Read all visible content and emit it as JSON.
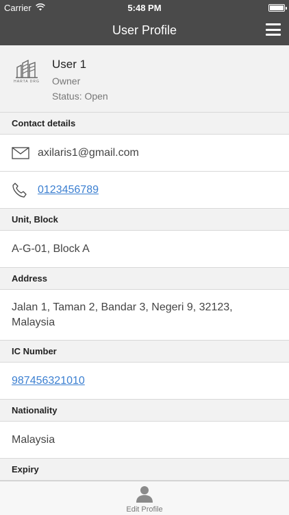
{
  "status_bar": {
    "carrier": "Carrier",
    "time": "5:48 PM"
  },
  "nav": {
    "title": "User Profile",
    "menu_icon": "hamburger-menu-icon"
  },
  "profile": {
    "logo_text": "HARTA DRG",
    "name": "User 1",
    "role": "Owner",
    "status": "Status: Open"
  },
  "contact": {
    "header": "Contact details",
    "email": "axilaris1@gmail.com",
    "email_icon": "envelope-icon",
    "phone": "0123456789",
    "phone_icon": "phone-icon"
  },
  "unit": {
    "header": "Unit, Block",
    "value": "A-G-01, Block A"
  },
  "address": {
    "header": "Address",
    "value": "Jalan 1, Taman 2, Bandar 3, Negeri 9, 32123, Malaysia"
  },
  "ic": {
    "header": "IC Number",
    "value": "987456321010"
  },
  "nationality": {
    "header": "Nationality",
    "value": "Malaysia"
  },
  "expiry": {
    "header": "Expiry"
  },
  "tab_bar": {
    "edit_profile_label": "Edit Profile",
    "edit_profile_icon": "person-icon"
  },
  "colors": {
    "nav_bg": "#4a4a4a",
    "section_bg": "#f2f2f2",
    "link": "#3b7fd1"
  }
}
